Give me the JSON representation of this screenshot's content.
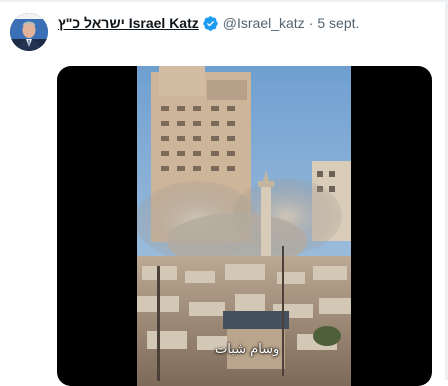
{
  "tweet": {
    "author_name": "ישראל כ\"ץ Israel Katz",
    "handle": "@Israel_katz",
    "separator": "·",
    "date": "5 sept.",
    "verified": true,
    "verified_color": "#1d9bf0"
  },
  "media": {
    "type": "video",
    "caption_overlay": "وسام شبات"
  },
  "icons": {
    "verified": "verified-badge-icon"
  }
}
